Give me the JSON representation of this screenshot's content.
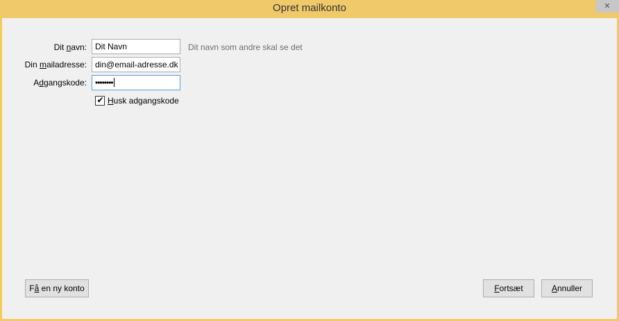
{
  "window": {
    "title": "Opret mailkonto",
    "close_icon": "close-icon"
  },
  "form": {
    "name_label_pre": "Dit ",
    "name_label_key": "n",
    "name_label_post": "avn:",
    "name_value": "Dit Navn",
    "name_hint": "Dit navn som andre skal se det",
    "email_label_pre": "Din ",
    "email_label_key": "m",
    "email_label_post": "ailadresse:",
    "email_value": "din@email-adresse.dk",
    "password_label_pre": "A",
    "password_label_key": "d",
    "password_label_post": "gangskode:",
    "password_masked": "••••••••",
    "remember_checked": true,
    "remember_mark": "✔",
    "remember_label_key": "H",
    "remember_label_post": "usk adgangskode"
  },
  "buttons": {
    "new_account_pre": "F",
    "new_account_key": "å",
    "new_account_post": " en ny konto",
    "continue_key": "F",
    "continue_post": "ortsæt",
    "cancel_key": "A",
    "cancel_post": "nnuller"
  }
}
